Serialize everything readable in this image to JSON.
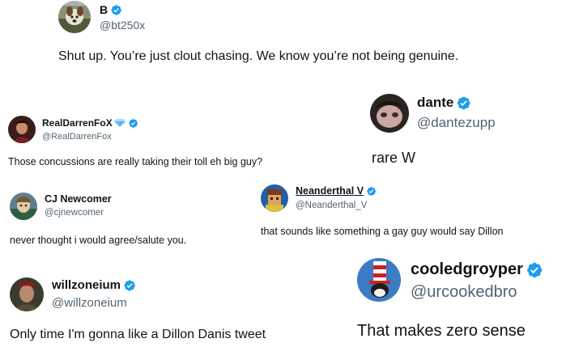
{
  "colors": {
    "verified_badge": "#1d9bf0",
    "handle_text": "#536471",
    "body_text": "#0f1419",
    "background": "#ffffff"
  },
  "tweets": [
    {
      "name": "B",
      "handle": "@bt250x",
      "text": "Shut up. You’re just clout chasing. We know you’re not being genuine.",
      "verified": true,
      "avatar": "profile-photo-dog"
    },
    {
      "name": "RealDarrenFoX",
      "handle": "@RealDarrenFox",
      "text": "Those concussions are really taking their toll eh big guy?",
      "verified": true,
      "extra_badge": "diamond-icon",
      "avatar": "profile-photo-person"
    },
    {
      "name": "dante",
      "handle": "@dantezupp",
      "text": "rare W",
      "verified": true,
      "avatar": "profile-photo-face"
    },
    {
      "name": "CJ Newcomer",
      "handle": "@cjnewcomer",
      "text": "never thought i would agree/salute you.",
      "verified": false,
      "avatar": "profile-photo-cartoon"
    },
    {
      "name": "Neanderthal V",
      "handle": "@Neanderthal_V",
      "text": "that sounds like something a gay guy would say Dillon",
      "verified": true,
      "avatar": "profile-photo-pixel-art"
    },
    {
      "name": "willzoneium",
      "handle": "@willzoneium",
      "text": "Only time I'm gonna like a Dillon Danis tweet",
      "verified": true,
      "avatar": "profile-photo-person"
    },
    {
      "name": "cooledgroyper",
      "handle": "@urcookedbro",
      "text": "That makes zero sense",
      "verified": true,
      "avatar": "profile-photo-cat-in-hat"
    }
  ]
}
